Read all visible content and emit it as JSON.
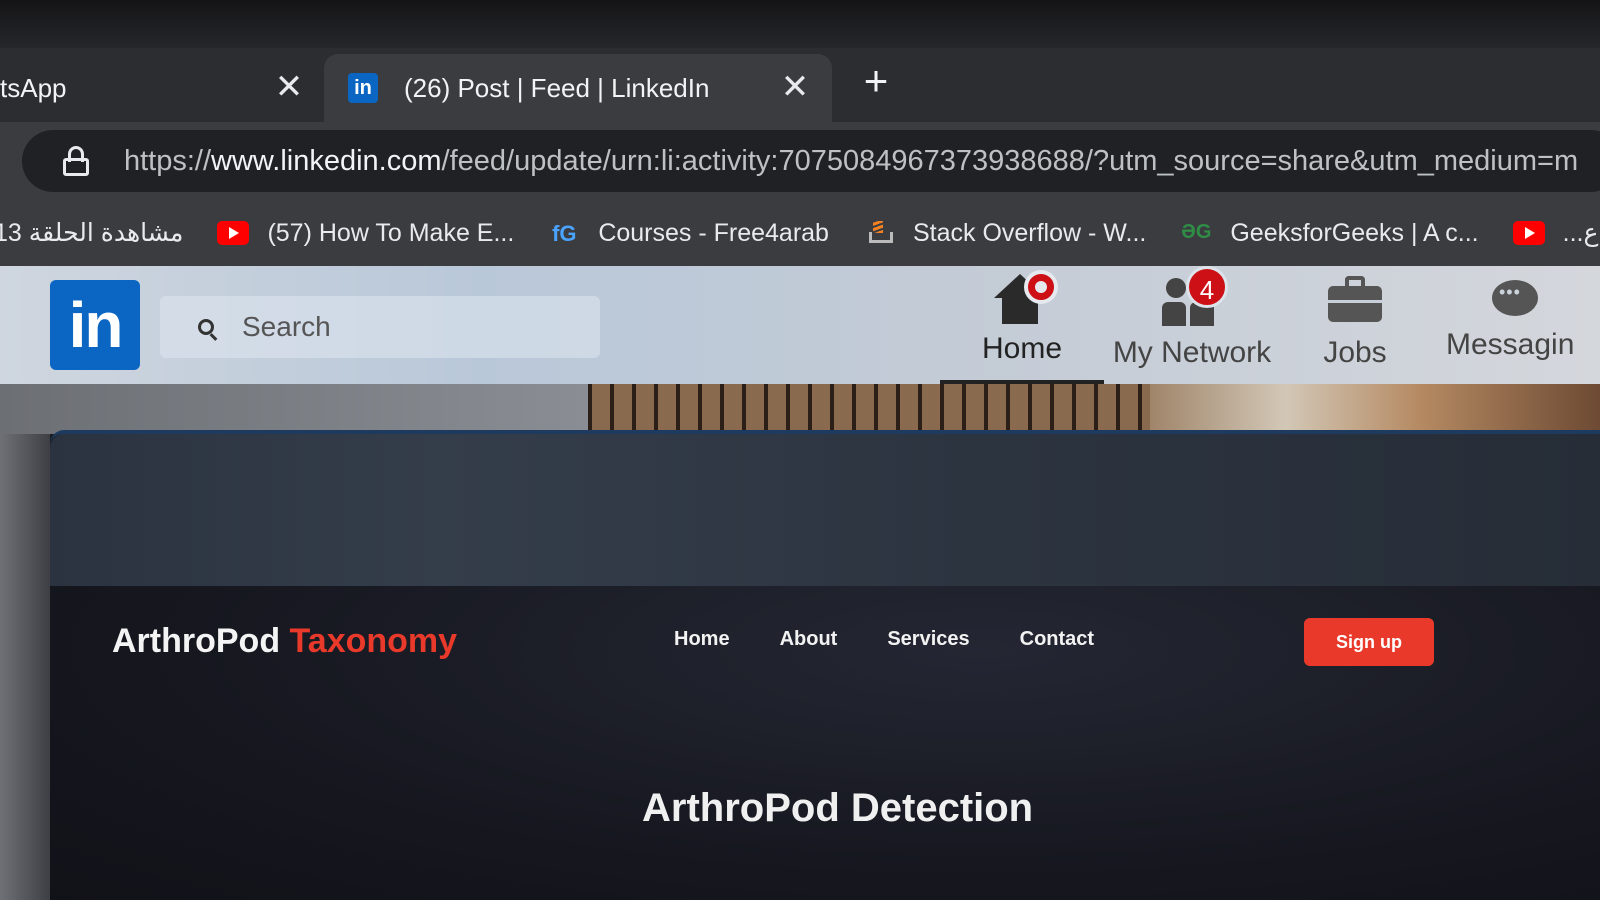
{
  "browser": {
    "tabs": [
      {
        "title": "tsApp",
        "active": false
      },
      {
        "title": "(26) Post | Feed | LinkedIn",
        "active": true,
        "favicon": "linkedin-icon"
      }
    ],
    "new_tab_label": "+",
    "close_glyph": "✕",
    "url_prefix": "https://",
    "url_domain": "www.linkedin.com",
    "url_path": "/feed/update/urn:li:activity:7075084967373938688/?utm_source=share&utm_medium=m",
    "bookmarks": [
      {
        "label": "مشاهدة الحلقة 13",
        "icon": "none"
      },
      {
        "label": "(57) How To Make E...",
        "icon": "youtube-icon"
      },
      {
        "label": "Courses - Free4arab",
        "icon": "free4arab-icon"
      },
      {
        "label": "Stack Overflow - W...",
        "icon": "stackoverflow-icon"
      },
      {
        "label": "GeeksforGeeks | A c...",
        "icon": "geeksforgeeks-icon"
      },
      {
        "label": "...ع",
        "icon": "youtube-icon"
      }
    ]
  },
  "linkedin": {
    "logo_text": "in",
    "search_placeholder": "Search",
    "nav": {
      "home": "Home",
      "network": "My Network",
      "network_badge": "4",
      "jobs": "Jobs",
      "messaging": "Messagin"
    }
  },
  "post_site": {
    "brand_main": "ArthroPod",
    "brand_accent": "Taxonomy",
    "nav": [
      "Home",
      "About",
      "Services",
      "Contact"
    ],
    "signup": "Sign up",
    "hero_title": "ArthroPod Detection"
  },
  "colors": {
    "linkedin_blue": "#0a66c2",
    "notification_red": "#cc1016",
    "site_accent": "#e8392a"
  }
}
